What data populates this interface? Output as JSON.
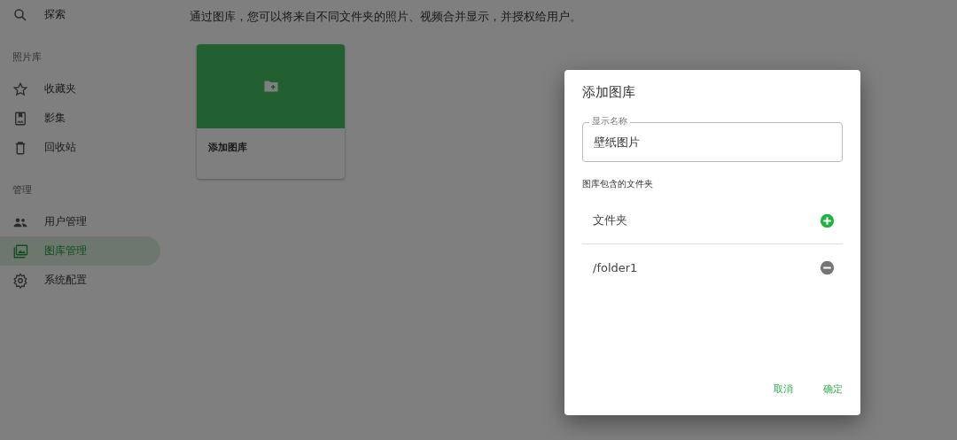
{
  "sidebar": {
    "sections": [
      {
        "items": [
          {
            "label": "探索",
            "selected": false
          }
        ]
      },
      {
        "heading": "照片库",
        "items": [
          {
            "label": "收藏夹",
            "selected": false
          },
          {
            "label": "影集",
            "selected": false
          },
          {
            "label": "回收站",
            "selected": false
          }
        ]
      },
      {
        "heading": "管理",
        "items": [
          {
            "label": "用户管理",
            "selected": false
          },
          {
            "label": "图库管理",
            "selected": true
          },
          {
            "label": "系统配置",
            "selected": false
          }
        ]
      }
    ]
  },
  "main": {
    "description": "通过图库，您可以将来自不同文件夹的照片、视频合并显示，并授权给用户。",
    "cards": [
      {
        "title": "添加图库"
      }
    ]
  },
  "dialog": {
    "title": "添加图库",
    "name_field": {
      "label": "显示名称",
      "value": "壁纸图片"
    },
    "folders_label": "图库包含的文件夹",
    "folders": [
      {
        "path": "文件夹",
        "kind": "add"
      },
      {
        "path": "/folder1",
        "kind": "remove"
      }
    ],
    "buttons": [
      "取消",
      "确定"
    ]
  }
}
